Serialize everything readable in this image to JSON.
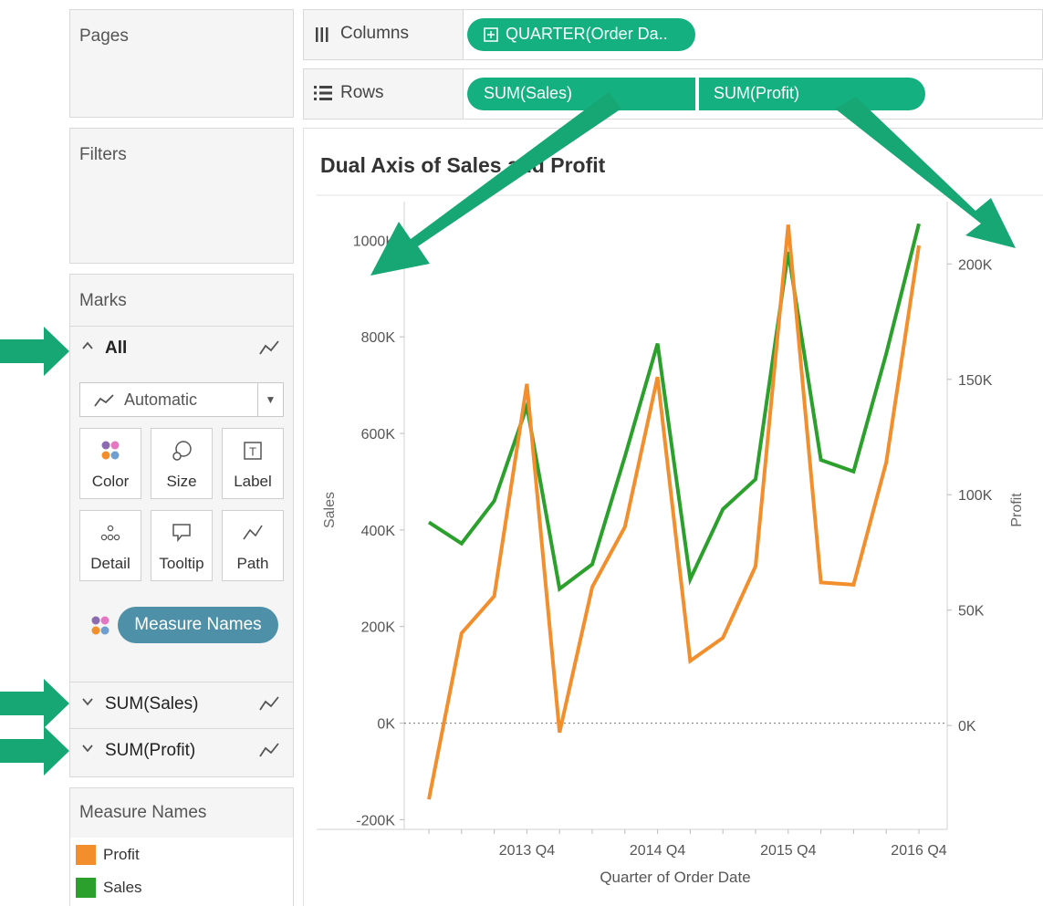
{
  "side_panels": {
    "pages_title": "Pages",
    "filters_title": "Filters",
    "marks_title": "Marks"
  },
  "marks": {
    "all_label": "All",
    "mark_type": "Automatic",
    "buttons": [
      "Color",
      "Size",
      "Label",
      "Detail",
      "Tooltip",
      "Path"
    ],
    "color_pill": "Measure Names",
    "measures": [
      "SUM(Sales)",
      "SUM(Profit)"
    ]
  },
  "legend": {
    "title": "Measure Names",
    "items": [
      {
        "label": "Profit",
        "color": "#f28e2b"
      },
      {
        "label": "Sales",
        "color": "#2ca02c"
      }
    ]
  },
  "shelves": {
    "columns_label": "Columns",
    "columns_pill": "QUARTER(Order Da..",
    "rows_label": "Rows",
    "rows_pills": [
      "SUM(Sales)",
      "SUM(Profit)"
    ]
  },
  "colors": {
    "pill_green": "#15b07f",
    "arrow_green": "#16a775",
    "sales": "#2ca02c",
    "profit": "#f28e2b",
    "measure_pill": "#4f90a9"
  },
  "icons": [
    "columns-icon",
    "rows-icon",
    "expand-box-icon",
    "chevron-up-icon",
    "chevron-down-icon",
    "line-mark-icon",
    "dropdown-caret-icon",
    "color-dots-icon",
    "size-icon",
    "label-icon",
    "detail-icon",
    "tooltip-icon",
    "path-icon",
    "annotation-arrow"
  ],
  "chart_data": {
    "type": "line",
    "title": "Dual Axis of Sales and Profit",
    "xlabel": "Quarter of Order Date",
    "ylabel": "Sales",
    "y2label": "Profit",
    "x_tick_labels": [
      "2013 Q4",
      "2014 Q4",
      "2015 Q4",
      "2016 Q4"
    ],
    "x": [
      "2013 Q1",
      "2013 Q2",
      "2013 Q3",
      "2013 Q4",
      "2014 Q1",
      "2014 Q2",
      "2014 Q3",
      "2014 Q4",
      "2015 Q1",
      "2015 Q2",
      "2015 Q3",
      "2015 Q4",
      "2016 Q1",
      "2016 Q2",
      "2016 Q3",
      "2016 Q4"
    ],
    "ylim": [
      -220000,
      1080000
    ],
    "y_ticks": [
      -200000,
      0,
      200000,
      400000,
      600000,
      800000,
      1000000
    ],
    "y_tick_labels": [
      "-200K",
      "0K",
      "200K",
      "400K",
      "600K",
      "800K",
      "1000K"
    ],
    "y2lim": [
      -45000,
      227000
    ],
    "y2_ticks": [
      0,
      50000,
      100000,
      150000,
      200000
    ],
    "y2_tick_labels": [
      "0K",
      "50K",
      "100K",
      "150K",
      "200K"
    ],
    "zero_line": true,
    "series": [
      {
        "name": "Sales",
        "axis": "left",
        "values": [
          416000,
          372000,
          460000,
          656000,
          278000,
          329000,
          552000,
          786000,
          298000,
          443000,
          505000,
          976000,
          545000,
          521000,
          765000,
          1034000
        ]
      },
      {
        "name": "Profit",
        "axis": "right",
        "values": [
          -32000,
          40000,
          56000,
          148000,
          -3000,
          60000,
          86000,
          151000,
          28000,
          38000,
          69000,
          217000,
          62000,
          61000,
          114000,
          208000
        ]
      }
    ]
  }
}
